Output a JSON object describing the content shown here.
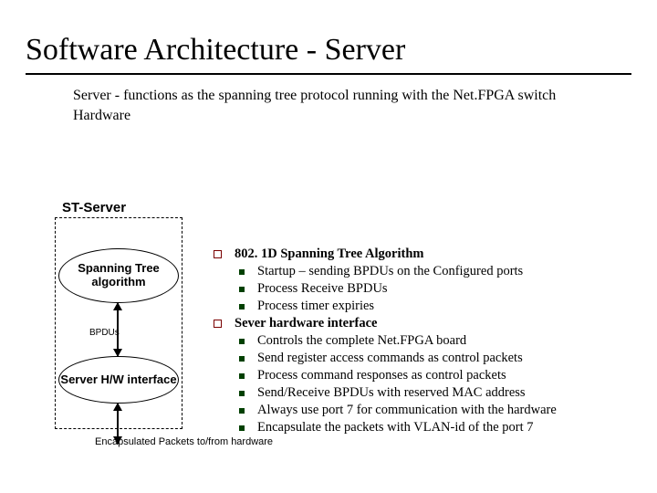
{
  "title": "Software Architecture - Server",
  "subtitle_lead": "Server",
  "subtitle_rest": " - functions as the spanning tree protocol running with the Net.FPGA switch Hardware",
  "st_label": "ST-Server",
  "oval1": "Spanning Tree algorithm",
  "oval2": "Server H/W interface",
  "bpdu": "BPDUs",
  "encap": "Encapsulated Packets to/from hardware",
  "sections": [
    {
      "heading": "802. 1D Spanning Tree Algorithm",
      "items": [
        "Startup – sending BPDUs on the Configured ports",
        "Process Receive BPDUs",
        "Process timer expiries"
      ]
    },
    {
      "heading": "Sever hardware interface",
      "items": [
        "Controls the complete Net.FPGA board",
        "Send register access commands as control packets",
        "Process command responses as control packets",
        "Send/Receive BPDUs with reserved MAC address",
        "Always use port 7 for communication with the hardware",
        "Encapsulate the packets with VLAN-id of the port 7"
      ]
    }
  ]
}
